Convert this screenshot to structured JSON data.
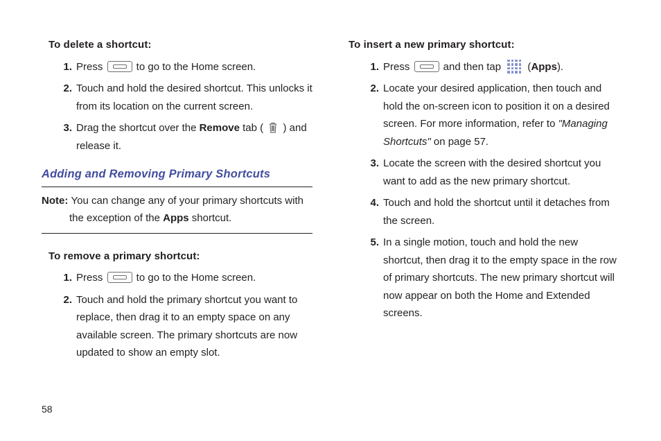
{
  "page_number": "58",
  "left": {
    "delete_title": "To delete a shortcut:",
    "delete_steps": {
      "1": {
        "a": "Press ",
        "b": " to go to the Home screen."
      },
      "2": "Touch and hold the desired shortcut. This unlocks it from its location on the current screen.",
      "3": {
        "a": "Drag the shortcut over the ",
        "b": "Remove",
        "c": " tab ( ",
        "d": " ) and release it."
      }
    },
    "heading": "Adding and Removing Primary Shortcuts",
    "note": {
      "label": "Note: ",
      "a": "You can change any of your primary shortcuts with the exception of the ",
      "b": "Apps",
      "c": " shortcut."
    },
    "remove_title": "To remove a primary shortcut:",
    "remove_steps": {
      "1": {
        "a": "Press ",
        "b": " to go to the Home screen."
      },
      "2": "Touch and hold the primary shortcut you want to replace, then drag it to an empty space on any available screen. The primary shortcuts are now updated to show an empty slot."
    }
  },
  "right": {
    "insert_title": "To insert a new primary shortcut:",
    "insert_steps": {
      "1": {
        "a": "Press ",
        "b": " and then tap ",
        "c": " (",
        "d": "Apps",
        "e": ")."
      },
      "2": {
        "a": "Locate your desired application, then touch and hold the on-screen icon to position it on a desired screen. For more information, refer to ",
        "b": "\"Managing Shortcuts\"",
        "c": " on page 57."
      },
      "3": "Locate the screen with the desired shortcut you want to add as the new primary shortcut.",
      "4": "Touch and hold the shortcut until it detaches from the screen.",
      "5": "In a single motion, touch and hold the new shortcut, then drag it to the empty space in the row of primary shortcuts. The new primary shortcut will now appear on both the Home and Extended screens."
    }
  }
}
